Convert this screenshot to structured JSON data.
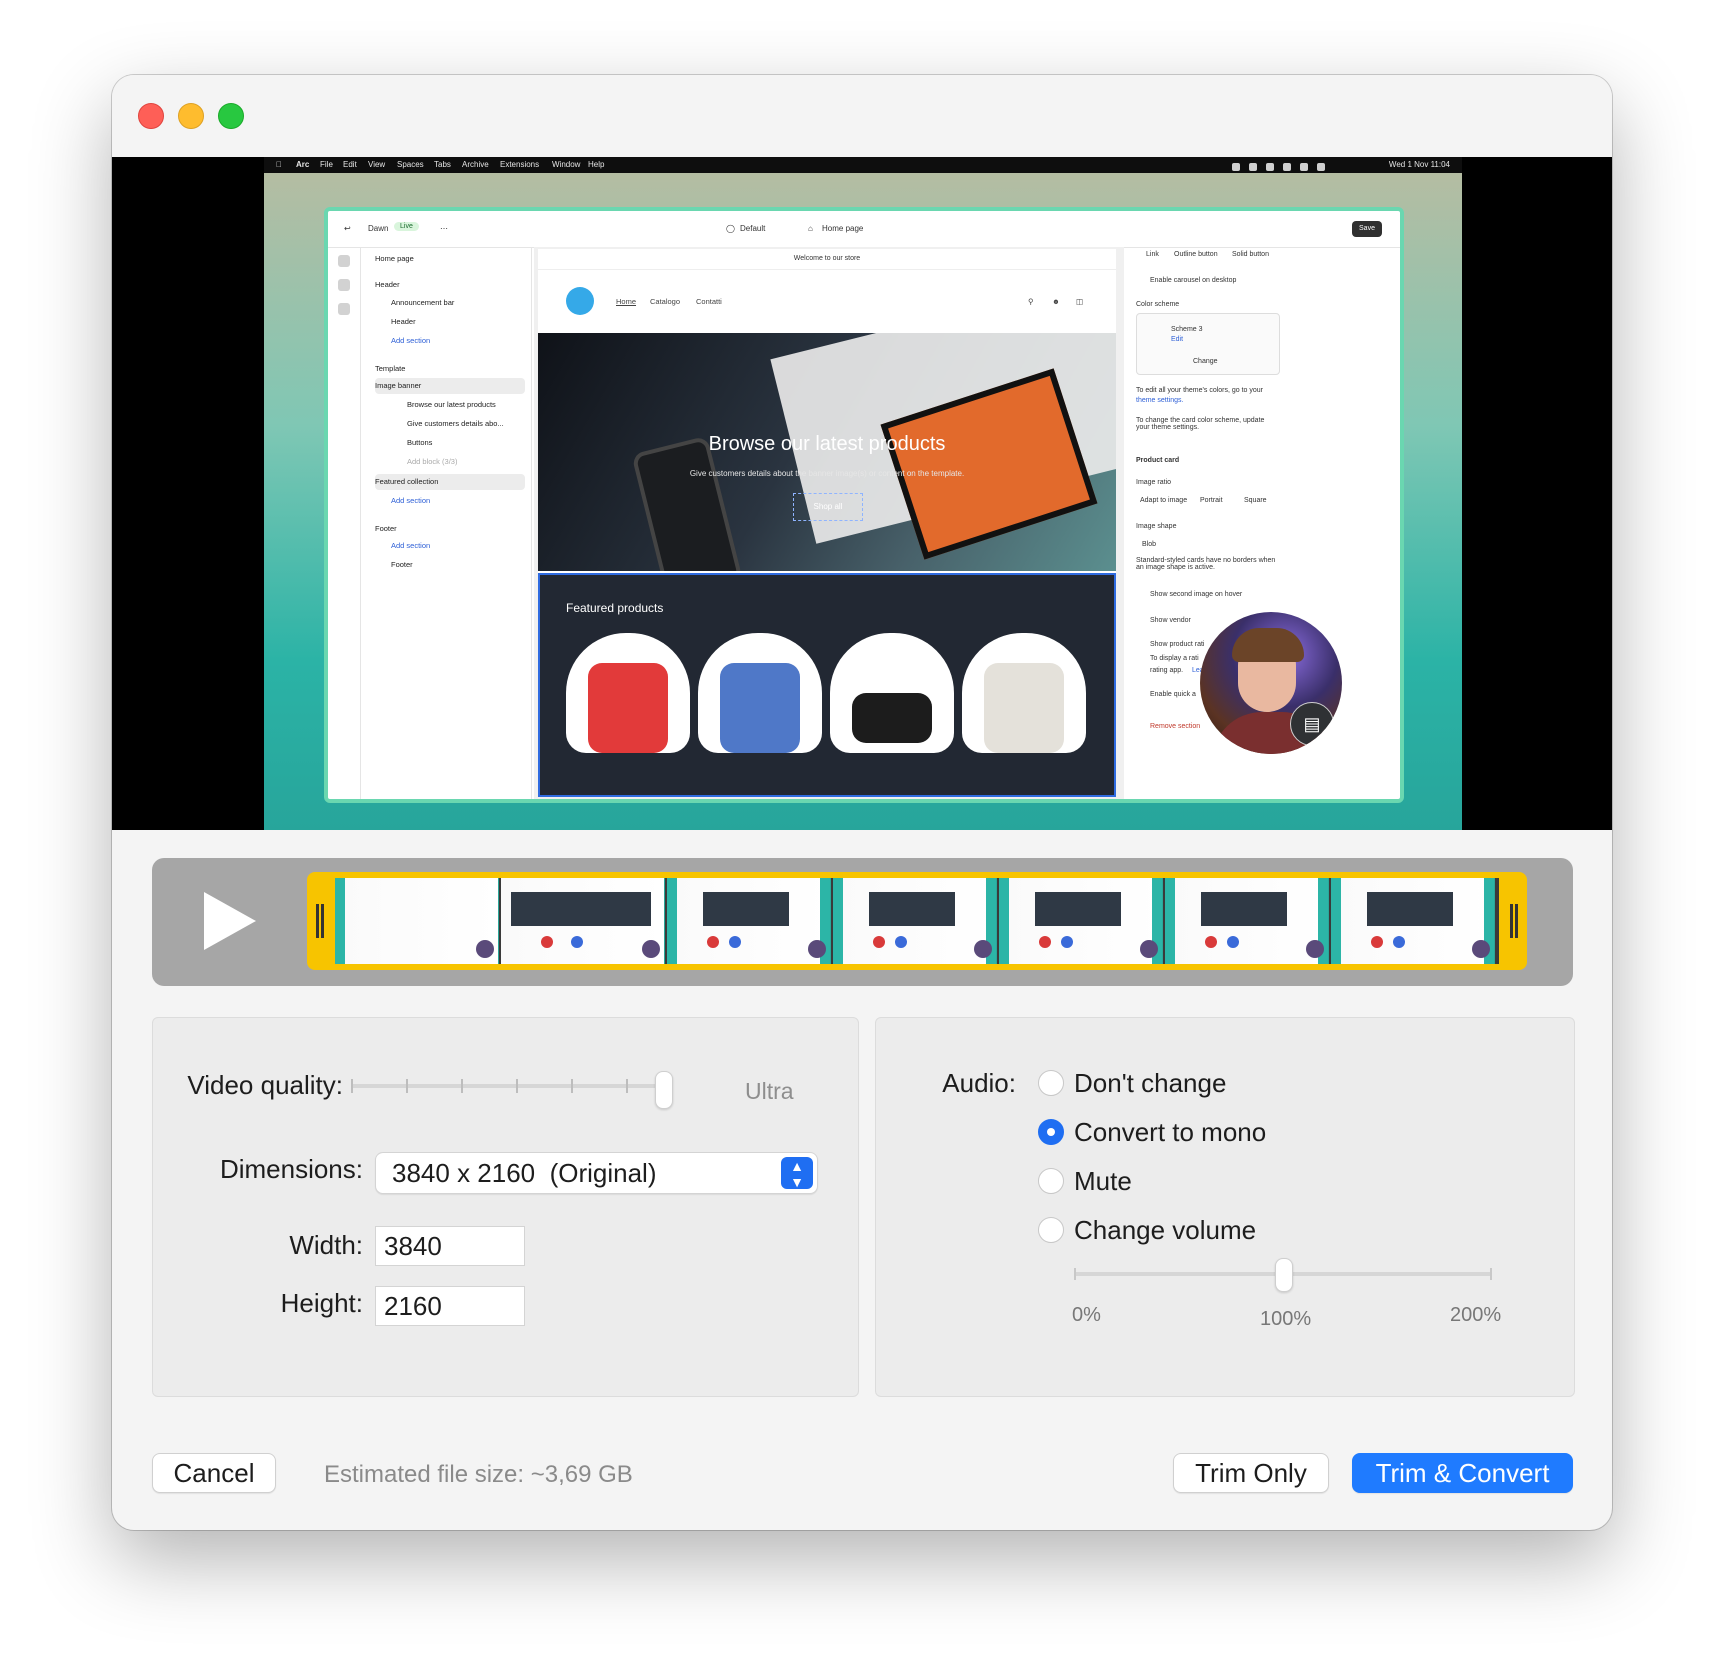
{
  "recording": {
    "menubar": {
      "items": [
        "Arc",
        "File",
        "Edit",
        "View",
        "Spaces",
        "Tabs",
        "Archive",
        "Extensions",
        "Window",
        "Help"
      ],
      "clock": "Wed 1 Nov 11:04"
    },
    "editor": {
      "store_name": "Dawn",
      "status_badge": "Live",
      "theme_select": "Default",
      "page_select": "Home page",
      "save_label": "Save",
      "sidebar": {
        "page_title": "Home page",
        "rows": [
          {
            "text": "Header",
            "kind": "heading"
          },
          {
            "text": "Announcement bar",
            "kind": "item"
          },
          {
            "text": "Header",
            "kind": "item"
          },
          {
            "text": "Add section",
            "kind": "link"
          },
          {
            "text": "Template",
            "kind": "heading"
          },
          {
            "text": "Image banner",
            "kind": "item"
          },
          {
            "text": "Browse our latest products",
            "kind": "sub"
          },
          {
            "text": "Give customers details abo...",
            "kind": "sub"
          },
          {
            "text": "Buttons",
            "kind": "sub"
          },
          {
            "text": "Add block (3/3)",
            "kind": "muted"
          },
          {
            "text": "Featured collection",
            "kind": "selected"
          },
          {
            "text": "Add section",
            "kind": "link"
          },
          {
            "text": "Footer",
            "kind": "heading"
          },
          {
            "text": "Add section",
            "kind": "link"
          },
          {
            "text": "Footer",
            "kind": "item"
          }
        ]
      },
      "store": {
        "announcement": "Welcome to our store",
        "nav": [
          "Home",
          "Catalogo",
          "Contatti"
        ],
        "banner_tag": "Image banner",
        "banner_heading": "Browse our latest products",
        "banner_sub": "Give customers details about the banner image(s) or content on the template.",
        "banner_button": "Shop all",
        "featured_title": "Featured products"
      },
      "settings": {
        "button_tabs": [
          "Link",
          "Outline button",
          "Solid button"
        ],
        "carousel": "Enable carousel on desktop",
        "color_scheme_label": "Color scheme",
        "scheme_name": "Scheme 3",
        "scheme_edit": "Edit",
        "scheme_change": "Change",
        "help1": "To edit all your theme's colors, go to your",
        "help1_link": "theme settings.",
        "help2": "To change the card color scheme, update your theme settings.",
        "product_card": "Product card",
        "image_ratio": "Image ratio",
        "ratio_options": [
          "Adapt to image",
          "Portrait",
          "Square"
        ],
        "image_shape": "Image shape",
        "shape_value": "Blob",
        "shape_help": "Standard-styled cards have no borders when an image shape is active.",
        "second_image": "Show second image on hover",
        "show_vendor": "Show vendor",
        "show_rating": "Show product rati",
        "rating_help": "To display a rati",
        "rating_help2": "rating app.",
        "rating_learn": "Lea",
        "quick_add": "Enable quick a",
        "remove": "Remove section"
      }
    }
  },
  "timeline": {
    "play_icon": "play-icon",
    "frame_count": 7
  },
  "video": {
    "quality_label": "Video quality:",
    "quality_value": "Ultra",
    "quality_level": 1.0,
    "dimensions_label": "Dimensions:",
    "dimensions_value": "3840 x 2160  (Original)",
    "width_label": "Width:",
    "width_value": "3840",
    "height_label": "Height:",
    "height_value": "2160"
  },
  "audio": {
    "label": "Audio:",
    "options": [
      {
        "label": "Don't change",
        "selected": false
      },
      {
        "label": "Convert to mono",
        "selected": true
      },
      {
        "label": "Mute",
        "selected": false
      },
      {
        "label": "Change volume",
        "selected": false
      }
    ],
    "volume_percent": 100,
    "volume_labels": [
      "0%",
      "100%",
      "200%"
    ]
  },
  "footer": {
    "cancel": "Cancel",
    "estimate": "Estimated file size: ~3,69 GB",
    "trim_only": "Trim Only",
    "trim_convert": "Trim & Convert"
  },
  "colors": {
    "accent": "#1f7bff",
    "trim_handle": "#f7c400",
    "editor_border": "#6ad7b0"
  }
}
